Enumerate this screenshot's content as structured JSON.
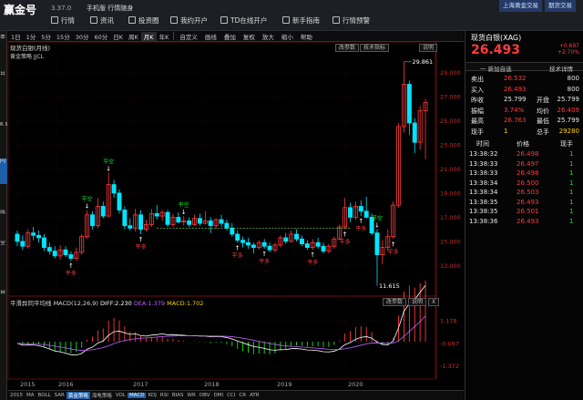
{
  "app": {
    "logo": "赢金号",
    "version": "3.37.0",
    "mobile": "手机版 行情随身",
    "nav": [
      "行情",
      "资讯",
      "投资圈",
      "我约开户",
      "TD在线开户",
      "新手指南",
      "行情预警"
    ],
    "top_buttons": [
      "上海黄金交易",
      "期货交易"
    ]
  },
  "left_tabs": [
    "本 分 析",
    "日 分 析",
    "K 线 图",
    "闪 电 图",
    "成 交 明 细",
    "全 局 历 史",
    "自 定 义 界 面"
  ],
  "toolbar": {
    "periods": [
      "1日",
      "1分",
      "5分",
      "15分",
      "30分",
      "60分",
      "日K",
      "周K",
      "月K",
      "年K"
    ],
    "tools": [
      "自定义",
      "画线",
      "叠加",
      "复权",
      "放大",
      "缩小",
      "帮助"
    ]
  },
  "price_panel": {
    "title": "现货白银(月线)",
    "product": "黄金策略 JJCL",
    "buttons": [
      "改参数",
      "技术指标",
      "说明"
    ],
    "axis": [
      "29.000",
      "27.000",
      "25.000",
      "23.000",
      "21.000",
      "19.000",
      "17.000",
      "15.000",
      "13.000"
    ],
    "hi_label": "29.861",
    "lo_label": "11.615"
  },
  "macd_panel": {
    "name": "平滑异同平均线",
    "params": "MACD(12,26,9)",
    "diff": "DIFF:2.230",
    "dea": "DEA:1.379",
    "macd": "MACD:1.702",
    "buttons": [
      "改参数",
      "说明",
      "X"
    ],
    "axis": [
      "1.178",
      "-0.097",
      "-1.372"
    ]
  },
  "x_axis": [
    "2015",
    "2016",
    "2017",
    "2018",
    "2019",
    "2020"
  ],
  "bottom_tabs": [
    "2015",
    "MA",
    "BOLL",
    "SAR",
    "黄金策略",
    "海龟策略",
    "VOL",
    "MACD",
    "KDJ",
    "RSI",
    "BIAS",
    "WR",
    "OBV",
    "DMI",
    "CCI",
    "CR",
    "ATR"
  ],
  "quote": {
    "name": "现货白银(XAG)",
    "price": "26.493",
    "change": "+0.697",
    "pct": "+2.70%",
    "bar": {
      "left": "一 新加自选",
      "right": "技术详情"
    },
    "rows": [
      {
        "k1": "卖出",
        "v1": "26.532",
        "c1": "red",
        "k2": "",
        "v2": "800",
        "c2": "wht"
      },
      {
        "k1": "买入",
        "v1": "26.493",
        "c1": "red",
        "k2": "",
        "v2": "800",
        "c2": "wht"
      },
      {
        "k1": "昨收",
        "v1": "25.799",
        "c1": "wht",
        "k2": "开盘",
        "v2": "25.799",
        "c2": "wht"
      },
      {
        "k1": "振幅",
        "v1": "3.74%",
        "c1": "red",
        "k2": "均价",
        "v2": "26.409",
        "c2": "red"
      },
      {
        "k1": "最高",
        "v1": "26.763",
        "c1": "red",
        "k2": "最低",
        "v2": "25.799",
        "c2": "wht"
      },
      {
        "k1": "现手",
        "v1": "1",
        "c1": "yel",
        "k2": "总手",
        "v2": "29280",
        "c2": "yel"
      }
    ],
    "tick_headers": [
      "时间",
      "价格",
      "现手"
    ],
    "ticks": [
      {
        "t": "13:38:32",
        "p": "26.498",
        "v": "1"
      },
      {
        "t": "13:38:33",
        "p": "26.497",
        "v": "1"
      },
      {
        "t": "13:38:33",
        "p": "26.498",
        "v": "1"
      },
      {
        "t": "13:38:34",
        "p": "26.500",
        "v": "1"
      },
      {
        "t": "13:38:34",
        "p": "26.503",
        "v": "1"
      },
      {
        "t": "13:38:35",
        "p": "26.493",
        "v": "1"
      },
      {
        "t": "13:38:35",
        "p": "26.501",
        "v": "1"
      },
      {
        "t": "13:38:36",
        "p": "26.493",
        "v": "1"
      }
    ]
  },
  "signals": {
    "buy": "买",
    "sell": "卖",
    "ping": "平空",
    "ping2": "平多"
  },
  "colors": {
    "up": "#ff3b3b",
    "down": "#00e5ff",
    "accent": "#1d5fa8",
    "diff": "#ffffff",
    "dea": "#c060ff"
  }
}
